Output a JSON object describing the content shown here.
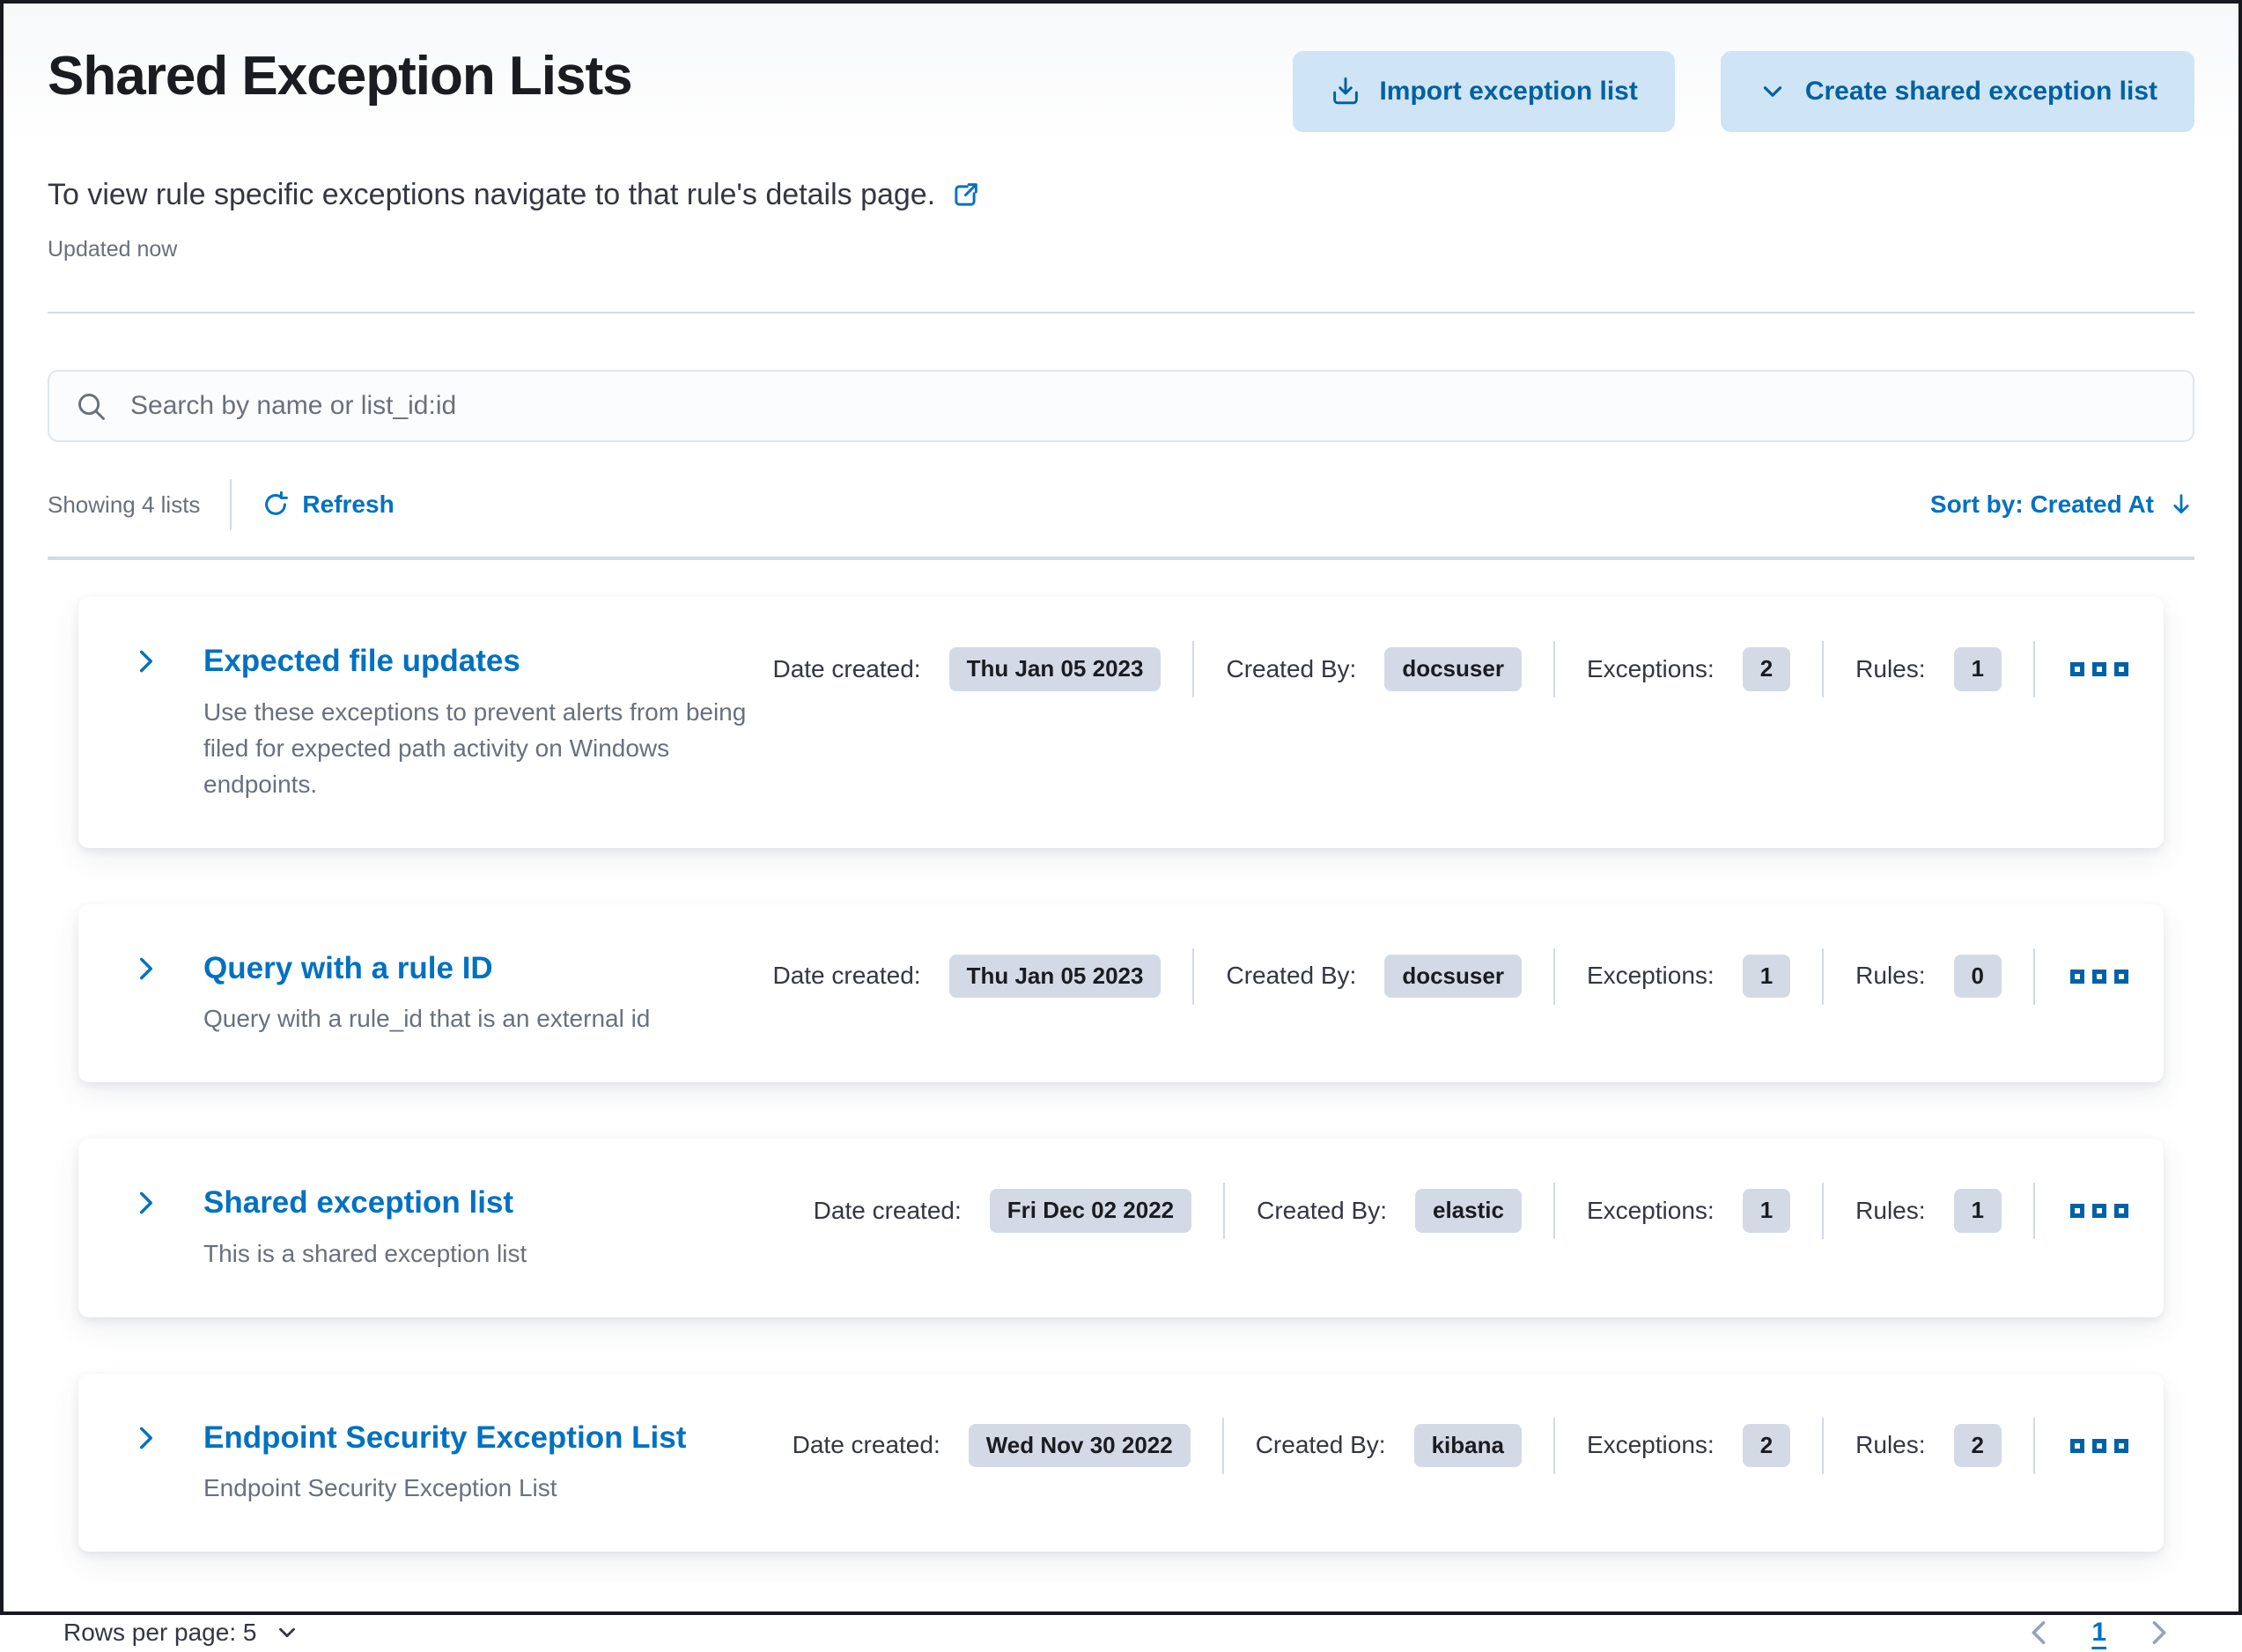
{
  "page": {
    "title": "Shared Exception Lists",
    "subtitle": "To view rule specific exceptions navigate to that rule's details page.",
    "updated": "Updated now"
  },
  "toolbar": {
    "import_label": "Import exception list",
    "create_label": "Create shared exception list"
  },
  "search": {
    "placeholder": "Search by name or list_id:id"
  },
  "utility": {
    "showing": "Showing 4 lists",
    "refresh_label": "Refresh",
    "sort_label": "Sort by: Created At"
  },
  "meta_labels": {
    "date_created": "Date created:",
    "created_by": "Created By:",
    "exceptions": "Exceptions:",
    "rules": "Rules:"
  },
  "lists": [
    {
      "name": "Expected file updates",
      "description": "Use these exceptions to prevent alerts from being filed for expected path activity on Windows endpoints.",
      "date_created": "Thu Jan 05 2023",
      "created_by": "docsuser",
      "exceptions": "2",
      "rules": "1"
    },
    {
      "name": "Query with a rule ID",
      "description": "Query with a rule_id that is an external id",
      "date_created": "Thu Jan 05 2023",
      "created_by": "docsuser",
      "exceptions": "1",
      "rules": "0"
    },
    {
      "name": "Shared exception list",
      "description": "This is a shared exception list",
      "date_created": "Fri Dec 02 2022",
      "created_by": "elastic",
      "exceptions": "1",
      "rules": "1"
    },
    {
      "name": "Endpoint Security Exception List",
      "description": "Endpoint Security Exception List",
      "date_created": "Wed Nov 30 2022",
      "created_by": "kibana",
      "exceptions": "2",
      "rules": "2"
    }
  ],
  "footer": {
    "rows_per_page": "Rows per page: 5",
    "page_number": "1"
  },
  "icons": {
    "import": "import-action-icon",
    "create": "chevron-down-icon",
    "external": "external-link-icon",
    "search": "search-icon",
    "refresh": "refresh-icon",
    "sort": "arrow-down-icon",
    "expand": "chevron-right-icon",
    "actions": "boxes-horizontal-icon",
    "prev": "chevron-left-icon",
    "next": "chevron-right-icon"
  },
  "colors": {
    "link_blue": "#0071c2",
    "button_text_blue": "#00619e",
    "button_bg_blue": "#cfe4f5",
    "badge_bg": "#d3dae6",
    "text_dark": "#343741",
    "text_gray": "#69707d",
    "divider": "#d3dae6",
    "pagination_chevron": "#98a2b3",
    "frame_border": "#17191e"
  }
}
